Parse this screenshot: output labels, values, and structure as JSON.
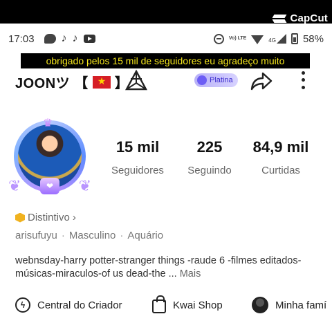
{
  "overlay": {
    "watermark": "CapCut"
  },
  "status_bar": {
    "time": "17:03",
    "notification_icons": [
      "chat-icon",
      "tiktok-icon",
      "tiktok-icon",
      "youtube-icon"
    ],
    "network_label": "Vo) LTE",
    "network_gen": "4G",
    "battery": "58%"
  },
  "caption": "obrigado pelos 15 mil de seguidores eu agradeço muito",
  "profile": {
    "username": "JOONツ",
    "flag_bracket_left": "【",
    "flag_bracket_right": "】",
    "badge_label": "Platina",
    "stats": [
      {
        "value": "15 mil",
        "label": "Seguidores"
      },
      {
        "value": "225",
        "label": "Seguindo"
      },
      {
        "value": "84,9 mil",
        "label": "Curtidas"
      }
    ],
    "distintivo": "Distintivo",
    "info": [
      "arisufuyu",
      "Masculino",
      "Aquário"
    ],
    "bio": "webnsday-harry potter-stranger things -raude 6 -filmes editados-músicas-miraculos-of us dead-the ...",
    "bio_more": "Mais"
  },
  "bottom_links": [
    {
      "label": "Central do Criador",
      "icon": "bolt-icon"
    },
    {
      "label": "Kwai Shop",
      "icon": "bag-icon"
    },
    {
      "label": "Minha famí",
      "icon": "avatar"
    }
  ],
  "colors": {
    "caption_text": "#f5e61c",
    "platina_bg": "#c9c2fb",
    "platina_text": "#3d2ccf"
  }
}
